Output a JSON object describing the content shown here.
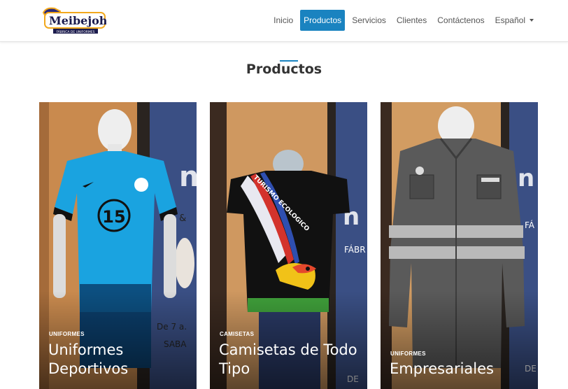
{
  "brand": {
    "name": "Meibejohn",
    "tagline": "FÁBRICA DE UNIFORMES"
  },
  "nav": {
    "items": [
      "Inicio",
      "Productos",
      "Servicios",
      "Clientes",
      "Contáctenos"
    ],
    "active": "Productos",
    "language": "Español"
  },
  "section": {
    "title": "Productos"
  },
  "products": [
    {
      "category": "UNIFORMES",
      "title": "Uniformes Deportivos",
      "jersey_number": "15"
    },
    {
      "category": "CAMISETAS",
      "title": "Camisetas de Todo Tipo",
      "print_text": "TURISMO ECOLOGICO"
    },
    {
      "category": "UNIFORMES",
      "title": "Empresariales"
    }
  ],
  "colors": {
    "accent": "#1a83c0"
  }
}
